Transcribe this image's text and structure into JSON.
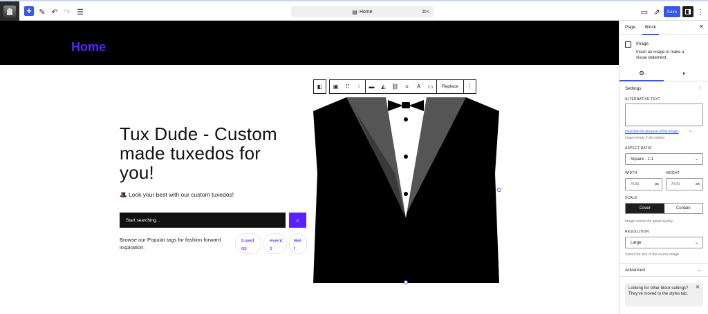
{
  "topbar": {
    "document_title": "Home",
    "shortcut": "⌘K",
    "save_label": "Save"
  },
  "canvas": {
    "site_title": "Home",
    "hero_heading": "Tux Dude - Custom made tuxedos for you!",
    "hero_sub": "🎩 Look your best with our custom tuxedos!",
    "search_placeholder": "Start searching...",
    "browse_text": "Browse our Popular tags for fashion forward inspiration:",
    "tags": [
      "tuxed os",
      "event s",
      "Bel t"
    ],
    "toolbar_replace": "Replace"
  },
  "sidebar": {
    "tab_page": "Page",
    "tab_block": "Block",
    "block_title": "Image",
    "block_desc": "Insert an image to make a visual statement.",
    "settings_heading": "Settings",
    "alt_label": "ALTERNATIVE TEXT",
    "alt_link": "Describe the purpose of the image.",
    "alt_help": "Leave empty if decorative.",
    "aspect_label": "ASPECT RATIO",
    "aspect_value": "Square - 1:1",
    "width_label": "WIDTH",
    "height_label": "HEIGHT",
    "width_placeholder": "Auto",
    "height_placeholder": "Auto",
    "unit": "px",
    "scale_label": "SCALE",
    "scale_cover": "Cover",
    "scale_contain": "Contain",
    "scale_help": "Image covers the space evenly.",
    "resolution_label": "RESOLUTION",
    "resolution_value": "Large",
    "resolution_help": "Select the size of the source image.",
    "advanced_label": "Advanced",
    "notice": "Looking for other block settings? They've moved to the styles tab."
  },
  "colors": {
    "accent": "#3858e9",
    "brand_purple": "#5b21ff",
    "header_black": "#000000"
  }
}
